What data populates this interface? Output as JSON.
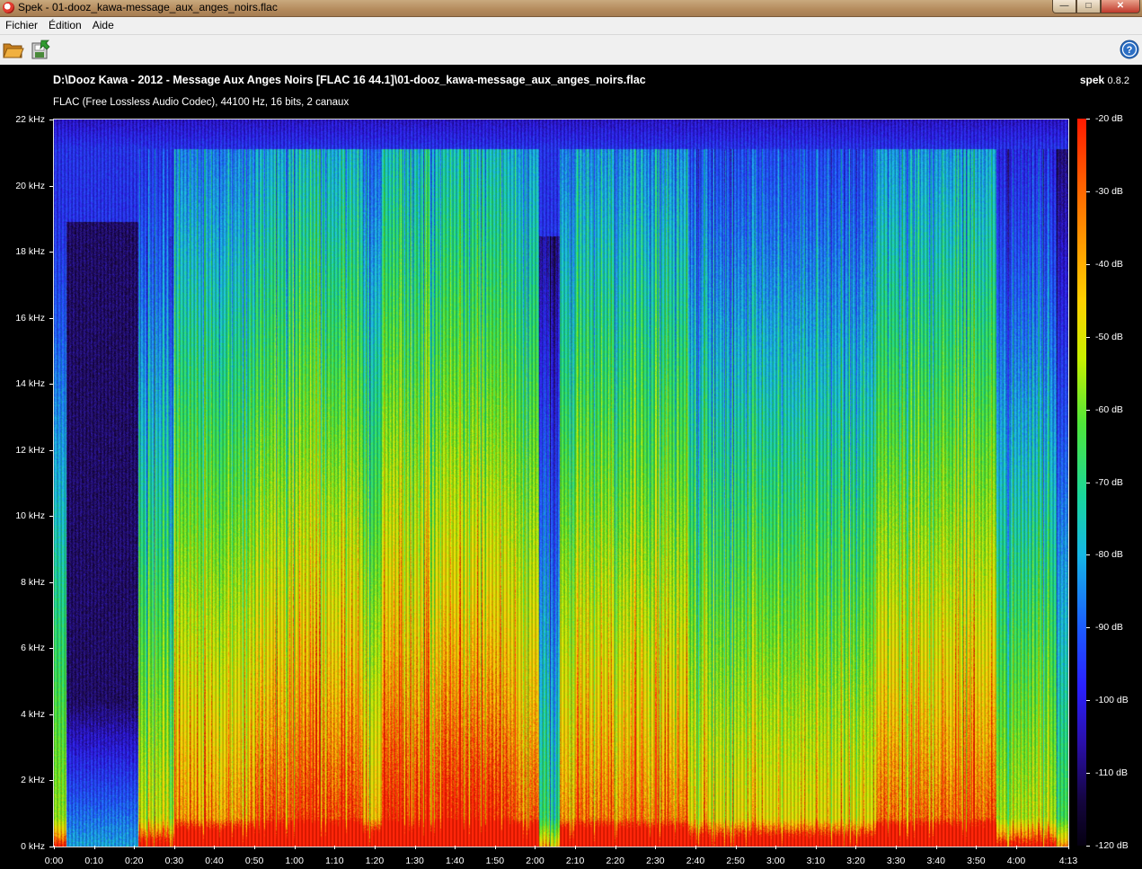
{
  "window": {
    "title": "Spek - 01-dooz_kawa-message_aux_anges_noirs.flac",
    "buttons": {
      "minimize": "—",
      "maximize": "□",
      "close": "✕"
    }
  },
  "menu": {
    "items": [
      "Fichier",
      "Édition",
      "Aide"
    ]
  },
  "toolbar": {
    "open_icon": "folder-open-icon",
    "save_icon": "save-icon",
    "help_icon": "help-icon"
  },
  "spectrogram": {
    "file_path": "D:\\Dooz Kawa - 2012 - Message Aux Anges Noirs [FLAC 16 44.1]\\01-dooz_kawa-message_aux_anges_noirs.flac",
    "file_info": "FLAC (Free Lossless Audio Codec), 44100 Hz, 16 bits, 2 canaux",
    "app_name": "spek",
    "app_version": "0.8.2",
    "freq_labels": [
      "22 kHz",
      "20 kHz",
      "18 kHz",
      "16 kHz",
      "14 kHz",
      "12 kHz",
      "10 kHz",
      "8 kHz",
      "6 kHz",
      "4 kHz",
      "2 kHz",
      "0 kHz"
    ],
    "time_labels": [
      "0:00",
      "0:10",
      "0:20",
      "0:30",
      "0:40",
      "0:50",
      "1:00",
      "1:10",
      "1:20",
      "1:30",
      "1:40",
      "1:50",
      "2:00",
      "2:10",
      "2:20",
      "2:30",
      "2:40",
      "2:50",
      "3:00",
      "3:10",
      "3:20",
      "3:30",
      "3:40",
      "3:50",
      "4:00",
      "4:13"
    ],
    "db_labels": [
      "-20 dB",
      "-30 dB",
      "-40 dB",
      "-50 dB",
      "-60 dB",
      "-70 dB",
      "-80 dB",
      "-90 dB",
      "-100 dB",
      "-110 dB",
      "-120 dB"
    ]
  }
}
